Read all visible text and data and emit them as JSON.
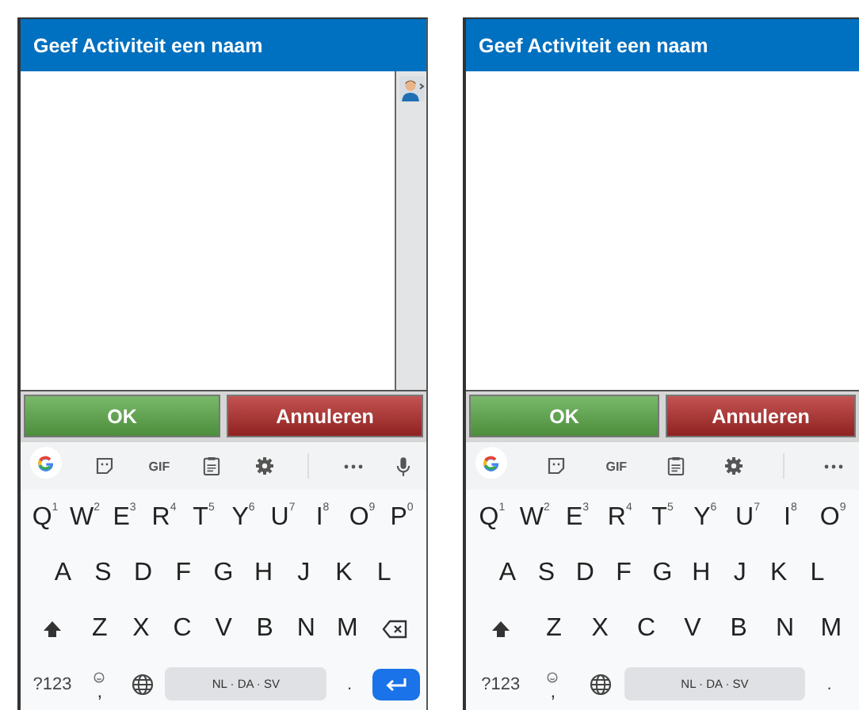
{
  "phones": [
    {
      "title": "Geef Activiteit een naam",
      "contact_picker": true,
      "buttons": [
        {
          "label": "OK",
          "kind": "ok"
        },
        {
          "label": "Annuleren",
          "kind": "cancel"
        }
      ],
      "keyboard": {
        "toolbar": [
          {
            "kind": "google"
          },
          {
            "kind": "sticker"
          },
          {
            "kind": "gif",
            "label": "GIF"
          },
          {
            "kind": "clipboard"
          },
          {
            "kind": "settings"
          },
          {
            "kind": "more"
          },
          {
            "kind": "mic"
          }
        ],
        "top_row": [
          {
            "kind": "letter",
            "label": "Q",
            "hint": "1"
          },
          {
            "kind": "letter",
            "label": "W",
            "hint": "2"
          },
          {
            "kind": "letter",
            "label": "E",
            "hint": "3"
          },
          {
            "kind": "letter",
            "label": "R",
            "hint": "4"
          },
          {
            "kind": "letter",
            "label": "T",
            "hint": "5"
          },
          {
            "kind": "letter",
            "label": "Y",
            "hint": "6"
          },
          {
            "kind": "letter",
            "label": "U",
            "hint": "7"
          },
          {
            "kind": "letter",
            "label": "I",
            "hint": "8"
          },
          {
            "kind": "letter",
            "label": "O",
            "hint": "9"
          },
          {
            "kind": "letter",
            "label": "P",
            "hint": "0"
          }
        ],
        "middle_row": [
          {
            "kind": "letter",
            "label": "A"
          },
          {
            "kind": "letter",
            "label": "S"
          },
          {
            "kind": "letter",
            "label": "D"
          },
          {
            "kind": "letter",
            "label": "F"
          },
          {
            "kind": "letter",
            "label": "G"
          },
          {
            "kind": "letter",
            "label": "H"
          },
          {
            "kind": "letter",
            "label": "J"
          },
          {
            "kind": "letter",
            "label": "K"
          },
          {
            "kind": "letter",
            "label": "L"
          }
        ],
        "lower_row": [
          {
            "kind": "shift"
          },
          {
            "kind": "letter",
            "label": "Z"
          },
          {
            "kind": "letter",
            "label": "X"
          },
          {
            "kind": "letter",
            "label": "C"
          },
          {
            "kind": "letter",
            "label": "V"
          },
          {
            "kind": "letter",
            "label": "B"
          },
          {
            "kind": "letter",
            "label": "N"
          },
          {
            "kind": "letter",
            "label": "M"
          },
          {
            "kind": "backspace"
          }
        ],
        "bottom_row": [
          {
            "kind": "symbols",
            "label": "?123"
          },
          {
            "kind": "comma",
            "label": ","
          },
          {
            "kind": "globe"
          },
          {
            "kind": "space",
            "label": "NL · DA · SV"
          },
          {
            "kind": "period",
            "label": "."
          },
          {
            "kind": "enter"
          }
        ]
      }
    },
    {
      "title": "Geef Activiteit een naam",
      "buttons": [
        {
          "label": "OK",
          "kind": "ok"
        },
        {
          "label": "Annuleren",
          "kind": "cancel"
        }
      ],
      "keyboard": {
        "toolbar": [
          {
            "kind": "google"
          },
          {
            "kind": "sticker"
          },
          {
            "kind": "gif",
            "label": "GIF"
          },
          {
            "kind": "clipboard"
          },
          {
            "kind": "settings"
          },
          {
            "kind": "more"
          }
        ],
        "top_row": [
          {
            "kind": "letter",
            "label": "Q",
            "hint": "1"
          },
          {
            "kind": "letter",
            "label": "W",
            "hint": "2"
          },
          {
            "kind": "letter",
            "label": "E",
            "hint": "3"
          },
          {
            "kind": "letter",
            "label": "R",
            "hint": "4"
          },
          {
            "kind": "letter",
            "label": "T",
            "hint": "5"
          },
          {
            "kind": "letter",
            "label": "Y",
            "hint": "6"
          },
          {
            "kind": "letter",
            "label": "U",
            "hint": "7"
          },
          {
            "kind": "letter",
            "label": "I",
            "hint": "8"
          },
          {
            "kind": "letter",
            "label": "O",
            "hint": "9"
          }
        ],
        "middle_row": [
          {
            "kind": "letter",
            "label": "A"
          },
          {
            "kind": "letter",
            "label": "S"
          },
          {
            "kind": "letter",
            "label": "D"
          },
          {
            "kind": "letter",
            "label": "F"
          },
          {
            "kind": "letter",
            "label": "G"
          },
          {
            "kind": "letter",
            "label": "H"
          },
          {
            "kind": "letter",
            "label": "J"
          },
          {
            "kind": "letter",
            "label": "K"
          },
          {
            "kind": "letter",
            "label": "L"
          }
        ],
        "lower_row": [
          {
            "kind": "shift"
          },
          {
            "kind": "letter",
            "label": "Z"
          },
          {
            "kind": "letter",
            "label": "X"
          },
          {
            "kind": "letter",
            "label": "C"
          },
          {
            "kind": "letter",
            "label": "V"
          },
          {
            "kind": "letter",
            "label": "B"
          },
          {
            "kind": "letter",
            "label": "N"
          },
          {
            "kind": "letter",
            "label": "M"
          }
        ],
        "bottom_row": [
          {
            "kind": "symbols",
            "label": "?123"
          },
          {
            "kind": "comma",
            "label": ","
          },
          {
            "kind": "globe"
          },
          {
            "kind": "space",
            "label": "NL · DA · SV"
          },
          {
            "kind": "period",
            "label": "."
          }
        ]
      }
    }
  ]
}
